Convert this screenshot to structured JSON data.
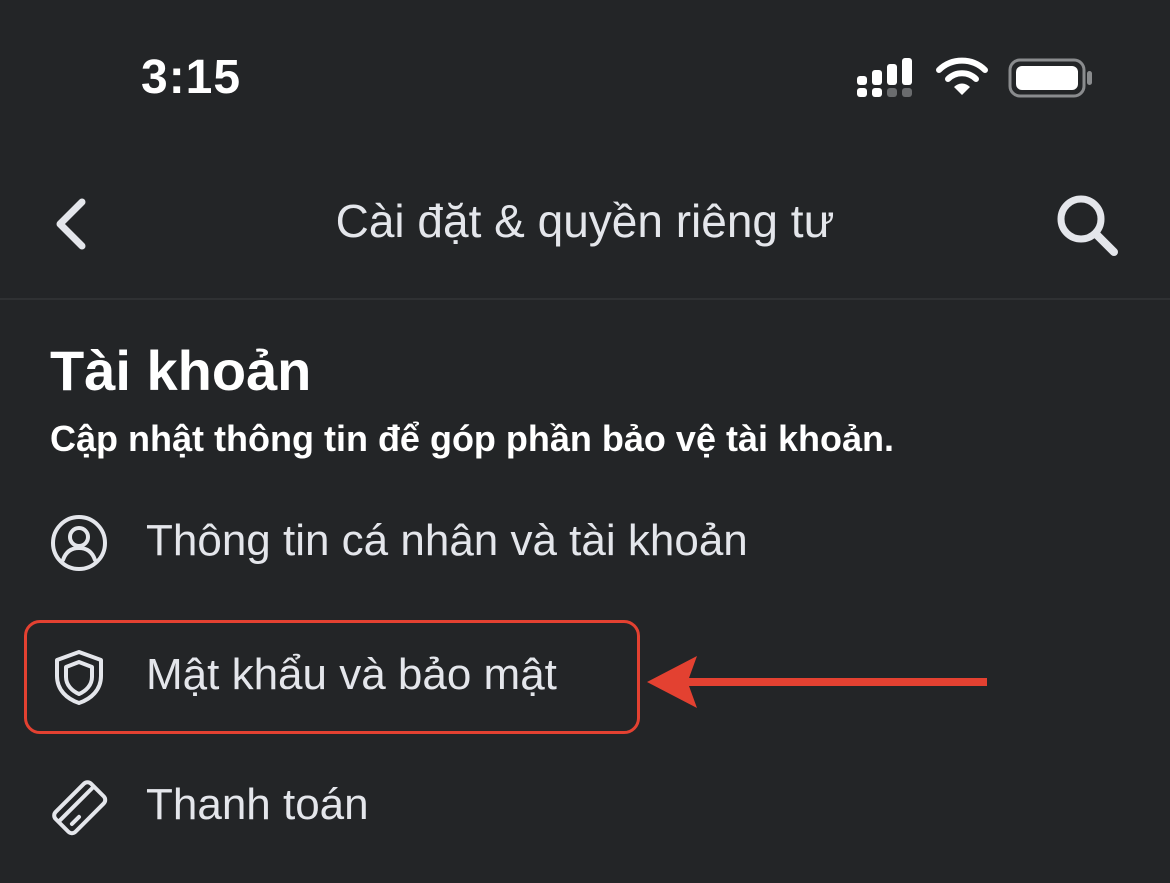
{
  "status_bar": {
    "time": "3:15"
  },
  "header": {
    "title": "Cài đặt & quyền riêng tư"
  },
  "section": {
    "title": "Tài khoản",
    "subtitle": "Cập nhật thông tin để góp phần bảo vệ tài khoản."
  },
  "items": [
    {
      "label": "Thông tin cá nhân và tài khoản",
      "icon": "person-circle-icon"
    },
    {
      "label": "Mật khẩu và bảo mật",
      "icon": "shield-icon",
      "highlighted": true
    },
    {
      "label": "Thanh toán",
      "icon": "card-icon"
    }
  ],
  "colors": {
    "background": "#232527",
    "text": "#e4e6eb",
    "highlight": "#e34131"
  }
}
